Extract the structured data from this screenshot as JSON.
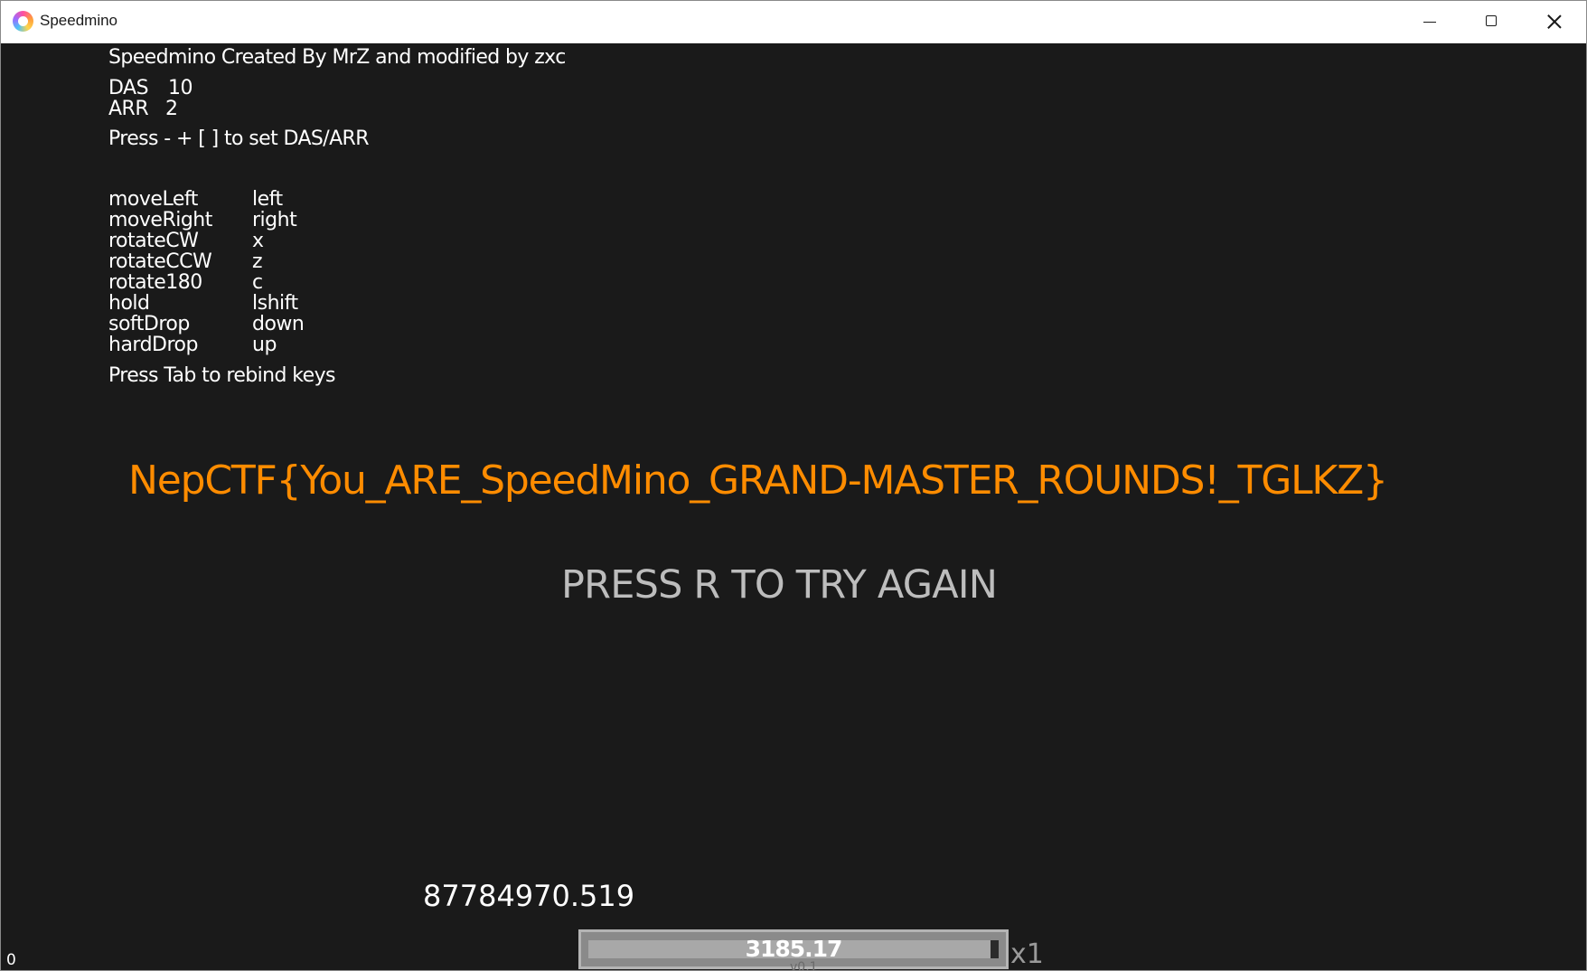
{
  "window": {
    "title": "Speedmino"
  },
  "game": {
    "credit": "Speedmino Created By MrZ and modified by zxc",
    "das": {
      "label": "DAS",
      "value": "10"
    },
    "arr": {
      "label": "ARR",
      "value": "2"
    },
    "dasarr_hint": "Press - + [ ] to set DAS/ARR",
    "bindings": [
      {
        "action": "moveLeft",
        "key": "left"
      },
      {
        "action": "moveRight",
        "key": "right"
      },
      {
        "action": "rotateCW",
        "key": "x"
      },
      {
        "action": "rotateCCW",
        "key": "z"
      },
      {
        "action": "rotate180",
        "key": "c"
      },
      {
        "action": "hold",
        "key": "lshift"
      },
      {
        "action": "softDrop",
        "key": "down"
      },
      {
        "action": "hardDrop",
        "key": "up"
      }
    ],
    "rebind_hint": "Press Tab to rebind keys",
    "flag": "NepCTF{You_ARE_SpeedMino_GRAND-MASTER_ROUNDS!_TGLKZ}",
    "retry": "PRESS R TO TRY AGAIN",
    "score": "87784970.519",
    "corner_counter": "0",
    "bar_value": "3185.17",
    "bar_fill_fraction": 0.98,
    "bar_version": "v0.1",
    "multiplier": "x1"
  },
  "colors": {
    "background": "#1a1a1a",
    "flag": "#ff8c00",
    "retry": "#bdbdbd"
  }
}
